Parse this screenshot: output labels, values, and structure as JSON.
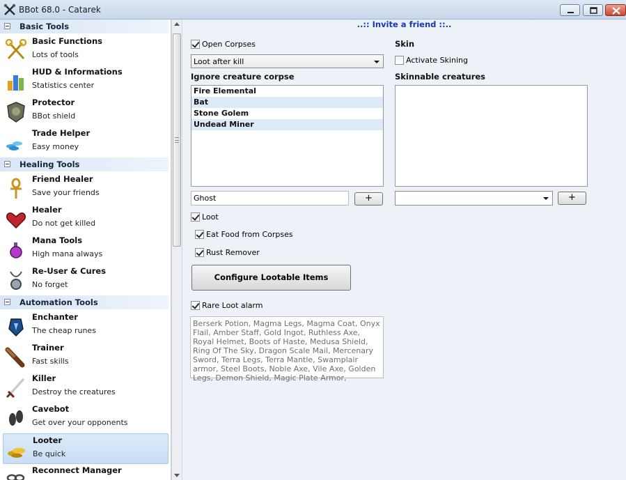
{
  "window": {
    "title": "BBot 68.0 - Catarek",
    "icon": "crossed-tools-icon"
  },
  "sidebar": {
    "groups": [
      {
        "label": "Basic Tools"
      },
      {
        "label": "Healing Tools"
      },
      {
        "label": "Automation Tools"
      }
    ],
    "items": [
      {
        "title": "Basic Functions",
        "subtitle": "Lots of tools",
        "icon": "crossed-keys-icon"
      },
      {
        "title": "HUD & Informations",
        "subtitle": "Statistics center",
        "icon": "bar-chart-icon"
      },
      {
        "title": "Protector",
        "subtitle": "BBot shield",
        "icon": "shield-helmet-icon"
      },
      {
        "title": "Trade Helper",
        "subtitle": "Easy money",
        "icon": "coins-icon"
      },
      {
        "title": "Friend Healer",
        "subtitle": "Save your friends",
        "icon": "ankh-icon"
      },
      {
        "title": "Healer",
        "subtitle": "Do not get killed",
        "icon": "heart-potion-icon"
      },
      {
        "title": "Mana Tools",
        "subtitle": "High mana always",
        "icon": "mana-potion-icon"
      },
      {
        "title": "Re-User & Cures",
        "subtitle": "No forget",
        "icon": "amulet-icon"
      },
      {
        "title": "Enchanter",
        "subtitle": "The cheap runes",
        "icon": "rune-icon"
      },
      {
        "title": "Trainer",
        "subtitle": "Fast skills",
        "icon": "club-icon"
      },
      {
        "title": "Killer",
        "subtitle": "Destroy the creatures",
        "icon": "sword-icon"
      },
      {
        "title": "Cavebot",
        "subtitle": "Get over your opponents",
        "icon": "footprints-icon"
      },
      {
        "title": "Looter",
        "subtitle": "Be quick",
        "icon": "gold-coins-icon",
        "selected": true
      },
      {
        "title": "Reconnect Manager",
        "subtitle": "",
        "icon": "chain-icon"
      }
    ]
  },
  "main": {
    "invite": "..:: Invite a friend ::..",
    "open_corpses": {
      "label": "Open Corpses",
      "checked": true
    },
    "loot_mode": {
      "value": "Loot after kill"
    },
    "ignore_label": "Ignore creature corpse",
    "ignore_list": [
      "Fire Elemental",
      "Bat",
      "Stone Golem",
      "Undead Miner"
    ],
    "ignore_input": {
      "value": "Ghost"
    },
    "add_label": "+",
    "skin": {
      "label": "Skin",
      "activate": {
        "label": "Activate Skining",
        "checked": false
      },
      "list_label": "Skinnable creatures",
      "list": [],
      "select_value": "",
      "add_label": "+"
    },
    "loot": {
      "label": "Loot",
      "checked": true
    },
    "eat_food": {
      "label": "Eat Food from Corpses",
      "checked": true
    },
    "rust_remover": {
      "label": "Rust Remover",
      "checked": true
    },
    "configure_button": "Configure Lootable Items",
    "rare_loot": {
      "label": "Rare Loot alarm",
      "checked": true
    },
    "rare_loot_items": "Berserk Potion, Magma Legs, Magma Coat, Onyx Flail, Amber Staff, Gold Ingot, Ruthless Axe, Royal Helmet, Boots of Haste, Medusa Shield, Ring Of The Sky, Dragon Scale Mail, Mercenary Sword, Terra Legs, Terra Mantle, Swamplair armor, Steel Boots, Noble Axe, Vile Axe, Golden Legs, Demon Shield, Magic Plate Armor,"
  }
}
